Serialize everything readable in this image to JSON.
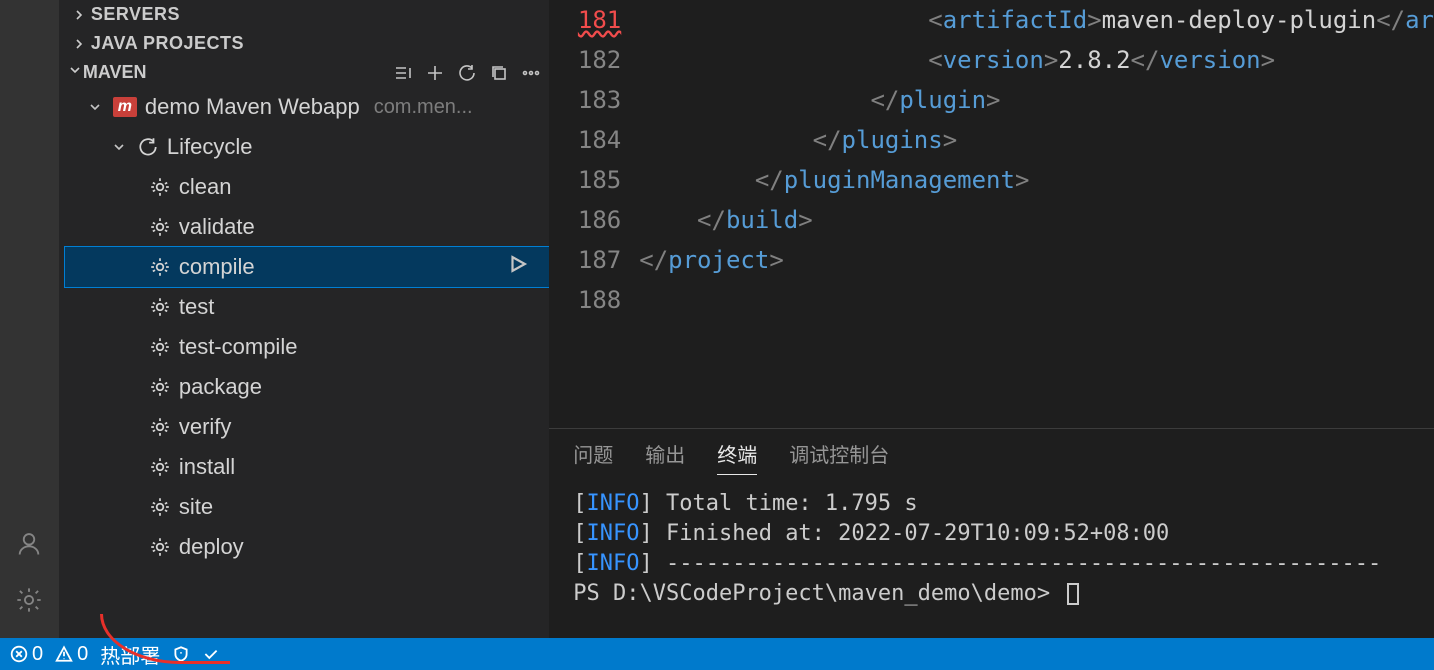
{
  "sidebar": {
    "sections": {
      "servers": "SERVERS",
      "java_projects": "JAVA PROJECTS",
      "maven": "MAVEN"
    },
    "project": {
      "name": "demo Maven Webapp",
      "group": "com.men..."
    },
    "lifecycle_label": "Lifecycle",
    "goals": [
      "clean",
      "validate",
      "compile",
      "test",
      "test-compile",
      "package",
      "verify",
      "install",
      "site",
      "deploy"
    ],
    "selected_goal": "compile"
  },
  "editor": {
    "lines": [
      {
        "num": "181",
        "bad": true,
        "indent": 20,
        "content": [
          {
            "t": "punct",
            "v": "<"
          },
          {
            "t": "tag",
            "v": "artifactId"
          },
          {
            "t": "punct",
            "v": ">"
          },
          {
            "t": "text",
            "v": "maven-deploy-plugin"
          },
          {
            "t": "punct",
            "v": "</"
          },
          {
            "t": "tag",
            "v": "ar"
          }
        ]
      },
      {
        "num": "182",
        "indent": 20,
        "content": [
          {
            "t": "punct",
            "v": "<"
          },
          {
            "t": "tag",
            "v": "version"
          },
          {
            "t": "punct",
            "v": ">"
          },
          {
            "t": "text",
            "v": "2.8.2"
          },
          {
            "t": "punct",
            "v": "</"
          },
          {
            "t": "tag",
            "v": "version"
          },
          {
            "t": "punct",
            "v": ">"
          }
        ]
      },
      {
        "num": "183",
        "indent": 16,
        "content": [
          {
            "t": "punct",
            "v": "</"
          },
          {
            "t": "tag",
            "v": "plugin"
          },
          {
            "t": "punct",
            "v": ">"
          }
        ]
      },
      {
        "num": "184",
        "indent": 12,
        "content": [
          {
            "t": "punct",
            "v": "</"
          },
          {
            "t": "tag",
            "v": "plugins"
          },
          {
            "t": "punct",
            "v": ">"
          }
        ]
      },
      {
        "num": "185",
        "indent": 8,
        "content": [
          {
            "t": "punct",
            "v": "</"
          },
          {
            "t": "tag",
            "v": "pluginManagement"
          },
          {
            "t": "punct",
            "v": ">"
          }
        ]
      },
      {
        "num": "186",
        "indent": 4,
        "content": [
          {
            "t": "punct",
            "v": "</"
          },
          {
            "t": "tag",
            "v": "build"
          },
          {
            "t": "punct",
            "v": ">"
          }
        ]
      },
      {
        "num": "187",
        "indent": 0,
        "content": [
          {
            "t": "punct",
            "v": "</"
          },
          {
            "t": "tag",
            "v": "project"
          },
          {
            "t": "punct",
            "v": ">"
          }
        ]
      },
      {
        "num": "188",
        "indent": 0,
        "content": []
      }
    ]
  },
  "panel": {
    "tabs": {
      "problems": "问题",
      "output": "输出",
      "terminal": "终端",
      "debug_console": "调试控制台"
    },
    "active_tab": "terminal",
    "terminal": {
      "info_label": "INFO",
      "line1": "Total time:  1.795 s",
      "line2": "Finished at: 2022-07-29T10:09:52+08:00",
      "line3_dashes": "------------------------------------------------------",
      "prompt": "PS D:\\VSCodeProject\\maven_demo\\demo> "
    }
  },
  "statusbar": {
    "errors": "0",
    "warnings": "0",
    "hot_deploy": "热部署"
  }
}
